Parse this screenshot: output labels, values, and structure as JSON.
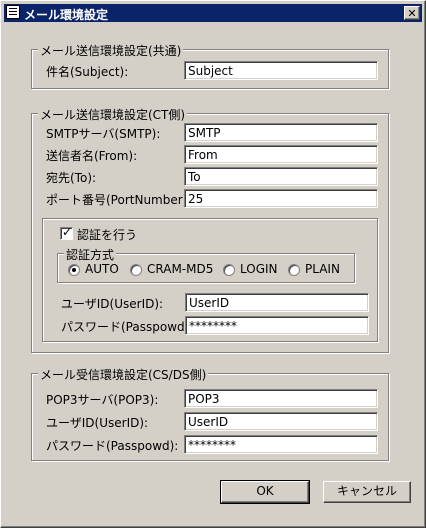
{
  "window": {
    "title": "メール環境設定",
    "close_label": "✕"
  },
  "common": {
    "legend": "メール送信環境設定(共通)",
    "subject_label": "件名(Subject):",
    "subject_value": "Subject"
  },
  "ct": {
    "legend": "メール送信環境設定(CT側)",
    "smtp_label": "SMTPサーバ(SMTP):",
    "smtp_value": "SMTP",
    "from_label": "送信者名(From):",
    "from_value": "From",
    "to_label": "宛先(To):",
    "to_value": "To",
    "port_label": "ポート番号(PortNumber):",
    "port_value": "25",
    "auth_check_label": "認証を行う",
    "auth_method_legend": "認証方式",
    "auth_methods": [
      "AUTO",
      "CRAM-MD5",
      "LOGIN",
      "PLAIN"
    ],
    "auth_selected": "AUTO",
    "userid_label": "ユーザID(UserID):",
    "userid_value": "UserID",
    "password_label": "パスワード(Passpowd):",
    "password_value": "********"
  },
  "cs": {
    "legend": "メール受信環境設定(CS/DS側)",
    "pop3_label": "POP3サーバ(POP3):",
    "pop3_value": "POP3",
    "userid_label": "ユーザID(UserID):",
    "userid_value": "UserID",
    "password_label": "パスワード(Passpowd):",
    "password_value": "********"
  },
  "buttons": {
    "ok": "OK",
    "cancel": "キャンセル"
  }
}
